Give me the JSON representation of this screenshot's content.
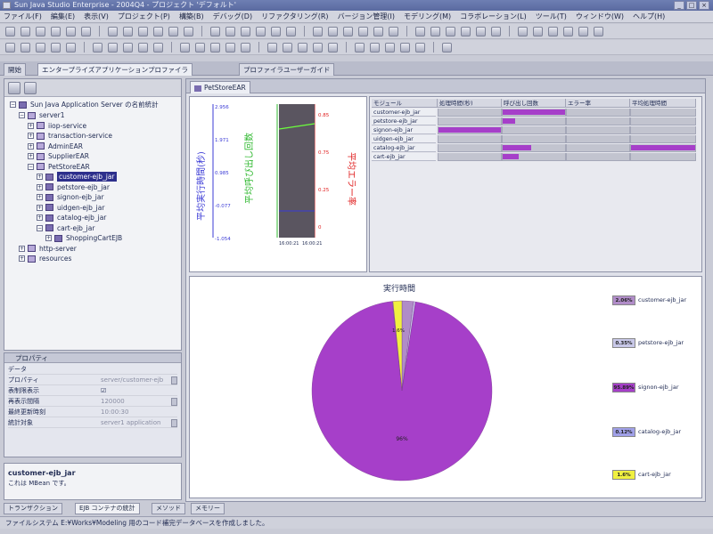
{
  "window": {
    "title": "Sun Java Studio Enterprise - 2004Q4 - プロジェクト 'デフォルト'",
    "buttons": [
      "_",
      "□",
      "×"
    ]
  },
  "menu": [
    "ファイル(F)",
    "編集(E)",
    "表示(V)",
    "プロジェクト(P)",
    "構築(B)",
    "デバッグ(D)",
    "リファクタリング(R)",
    "バージョン管理(I)",
    "モデリング(M)",
    "コラボレーション(L)",
    "ツール(T)",
    "ウィンドウ(W)",
    "ヘルプ(H)"
  ],
  "editor_tabs": [
    {
      "label": "開始"
    },
    {
      "label": "エンタープライズアプリケーションプロファイラ"
    },
    {
      "label": "プロファイラユーザーガイド"
    }
  ],
  "sub_tab": {
    "label": "PetStoreEAR"
  },
  "tree": {
    "root": "Sun Java Application Server の名前統計",
    "items": [
      {
        "label": "server1",
        "level": 1,
        "expanded": true
      },
      {
        "label": "iiop-service",
        "level": 2,
        "expanded": false
      },
      {
        "label": "transaction-service",
        "level": 2,
        "expanded": false
      },
      {
        "label": "AdminEAR",
        "level": 2,
        "expanded": false
      },
      {
        "label": "SupplierEAR",
        "level": 2,
        "expanded": false
      },
      {
        "label": "PetStoreEAR",
        "level": 2,
        "expanded": true
      },
      {
        "label": "customer-ejb_jar",
        "level": 3,
        "expanded": false,
        "selected": true
      },
      {
        "label": "petstore-ejb_jar",
        "level": 3,
        "expanded": false
      },
      {
        "label": "signon-ejb_jar",
        "level": 3,
        "expanded": false
      },
      {
        "label": "uidgen-ejb_jar",
        "level": 3,
        "expanded": false
      },
      {
        "label": "catalog-ejb_jar",
        "level": 3,
        "expanded": false
      },
      {
        "label": "cart-ejb_jar",
        "level": 3,
        "expanded": true
      },
      {
        "label": "ShoppingCartEJB",
        "level": 4,
        "expanded": false
      },
      {
        "label": "http-server",
        "level": 1,
        "expanded": false
      },
      {
        "label": "resources",
        "level": 1,
        "expanded": false
      }
    ]
  },
  "properties": {
    "title": "プロパティ",
    "rows": [
      {
        "key": "データ",
        "value": ""
      },
      {
        "key": "プロパティ",
        "value": "server/customer-ejb"
      },
      {
        "key": "表制限表示",
        "value": "☑"
      },
      {
        "key": "再表示間隔",
        "value": "120000"
      },
      {
        "key": "最終更新時刻",
        "value": "10:00:30"
      },
      {
        "key": "統計対象",
        "value": "server1 application"
      }
    ]
  },
  "description": {
    "title": "customer-ejb_jar",
    "text": "これは MBean です。"
  },
  "bottom_tabs": [
    "トランザクション",
    "EJB コンテナの統計",
    "メソッド",
    "メモリー"
  ],
  "status": "ファイルシステム E:¥Works¥Modeling 用のコード補完データベースを作成しました。",
  "colors": {
    "accent_purple": "#a63fc9",
    "selection": "#2d2f8c",
    "avg_exec_axis": "#3b3bd6",
    "calls_axis": "#2fb82f",
    "errors_axis": "#e02020"
  },
  "line_chart": {
    "left_axis_label": "平均実行時間(秒)",
    "mid_axis_label": "平均呼び出し回数",
    "right_axis_label": "平均エラー率",
    "left_ticks": [
      "2.956",
      "1.971",
      "0.985",
      "-0.077",
      "-1.054"
    ],
    "right_ticks": [
      "0.85",
      "0.75",
      "0.25",
      "0"
    ],
    "x_ticks": [
      "16:00:21",
      "16:00:21"
    ]
  },
  "grid": {
    "headers": [
      "モジュール",
      "処理時間(秒)",
      "呼び出し回数",
      "エラー率",
      "平均処理時間"
    ],
    "rows": [
      {
        "name": "customer-ejb_jar",
        "bars": [
          0,
          1.0,
          0,
          0
        ]
      },
      {
        "name": "petstore-ejb_jar",
        "bars": [
          0,
          0.2,
          0,
          0
        ]
      },
      {
        "name": "signon-ejb_jar",
        "bars": [
          1.0,
          0,
          0,
          0
        ]
      },
      {
        "name": "uidgen-ejb_jar",
        "bars": [
          0,
          0,
          0,
          0
        ]
      },
      {
        "name": "catalog-ejb_jar",
        "bars": [
          0,
          0.45,
          0,
          1.0
        ]
      },
      {
        "name": "cart-ejb_jar",
        "bars": [
          0,
          0.25,
          0,
          0
        ]
      }
    ]
  },
  "chart_data": {
    "type": "pie",
    "title": "実行時間",
    "categories": [
      "customer-ejb_jar",
      "petstore-ejb_jar",
      "signon-ejb_jar",
      "catalog-ejb_jar",
      "cart-ejb_jar"
    ],
    "values": [
      2.06,
      0.35,
      95.89,
      0.12,
      1.6
    ],
    "value_labels": [
      "2.06%",
      "0.35%",
      "95.89%",
      "0.12%",
      "1.6%"
    ],
    "colors": [
      "#b08cc8",
      "#c8c8e8",
      "#a63fc9",
      "#a0a0e8",
      "#f0f040"
    ],
    "slice_labels": [
      "96%",
      "1.6%"
    ],
    "legend_placement": "right"
  }
}
